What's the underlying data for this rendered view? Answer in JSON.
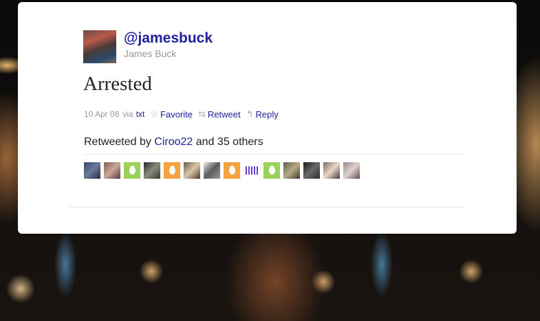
{
  "tweet": {
    "handle": "@jamesbuck",
    "full_name": "James Buck",
    "text": "Arrested",
    "date": "10 Apr 08",
    "via_label": "via",
    "via_source": "txt",
    "actions": {
      "favorite": "Favorite",
      "retweet": "Retweet",
      "reply": "Reply"
    },
    "retweeted": {
      "prefix": "Retweeted by",
      "user": "Ciroo22",
      "suffix": "and 35 others"
    }
  },
  "icons": {
    "favorite": "☆",
    "retweet": "⇆",
    "reply": "↰"
  },
  "colors": {
    "link": "#1f1f9f",
    "muted": "#999999",
    "card": "#ffffff"
  }
}
